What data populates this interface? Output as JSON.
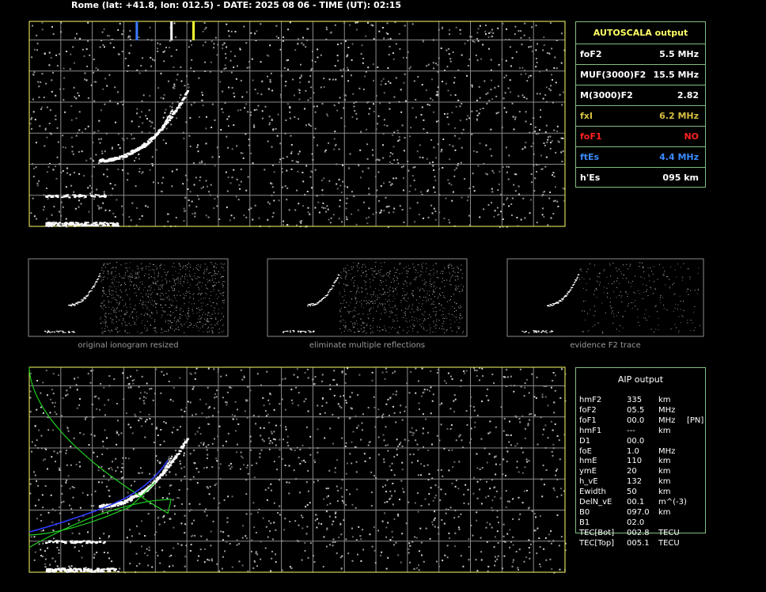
{
  "header": {
    "title": "Rome (lat: +41.8, lon: 012.5) - DATE: 2025 08 06 - TIME (UT): 02:15"
  },
  "main_ionogram": {
    "y_unit": "km",
    "x_unit": "MHz",
    "y_ticks": [
      "760",
      "700",
      "600",
      "500",
      "400",
      "300",
      "200",
      "100"
    ],
    "x_ticks": [
      "1",
      "2",
      "3",
      "4",
      "5",
      "6",
      "7",
      "8",
      "9",
      "10",
      "11",
      "12",
      "13",
      "14",
      "15",
      "16",
      "17",
      "18"
    ],
    "markers": [
      {
        "label": "ftEs",
        "freq": 4.4,
        "color": "#3a7bff"
      },
      {
        "label": "foF2",
        "freq": 5.5,
        "color": "#ffffff"
      },
      {
        "label": "fxI",
        "freq": 6.2,
        "color": "#ffff33"
      }
    ]
  },
  "autoscala": {
    "title": "AUTOSCALA output",
    "rows": [
      {
        "label": "foF2",
        "value": "5.5 MHz",
        "color": "#ffffff"
      },
      {
        "label": "MUF(3000)F2",
        "value": "15.5 MHz",
        "color": "#ffffff"
      },
      {
        "label": "M(3000)F2",
        "value": "2.82",
        "color": "#ffffff"
      },
      {
        "label": "fxI",
        "value": "6.2 MHz",
        "color": "#d8c040"
      },
      {
        "label": "foF1",
        "value": "NO",
        "color": "#ff2020"
      },
      {
        "label": "ftEs",
        "value": "4.4 MHz",
        "color": "#3a8bff"
      },
      {
        "label": "h'Es",
        "value": "095    km",
        "color": "#ffffff"
      }
    ]
  },
  "thumbnails": [
    {
      "caption": "original ionogram resized"
    },
    {
      "caption": "eliminate multiple reflections"
    },
    {
      "caption": "evidence F2 trace"
    }
  ],
  "aip_ionogram": {
    "y_unit": "km",
    "x_unit": "MHz",
    "y_ticks": [
      "760",
      "700",
      "600",
      "500",
      "400",
      "300",
      "200",
      "100"
    ],
    "x_ticks": [
      "1",
      "2",
      "3",
      "4",
      "5",
      "6",
      "7",
      "8",
      "9",
      "10",
      "11",
      "12",
      "13",
      "14",
      "15",
      "16",
      "17",
      "18"
    ]
  },
  "aip": {
    "title": "AIP output",
    "rows": [
      {
        "name": "hmF2",
        "value": "335",
        "unit": "km",
        "extra": ""
      },
      {
        "name": "foF2",
        "value": "05.5",
        "unit": "MHz",
        "extra": ""
      },
      {
        "name": "foF1",
        "value": "00.0",
        "unit": "MHz",
        "extra": "[PN]"
      },
      {
        "name": "hmF1",
        "value": "---",
        "unit": "km",
        "extra": ""
      },
      {
        "name": "D1",
        "value": "00.0",
        "unit": "",
        "extra": ""
      },
      {
        "name": "foE",
        "value": "1.0",
        "unit": "MHz",
        "extra": ""
      },
      {
        "name": "hmE",
        "value": "110",
        "unit": "km",
        "extra": ""
      },
      {
        "name": "ymE",
        "value": "20",
        "unit": "km",
        "extra": ""
      },
      {
        "name": "h_vE",
        "value": "132",
        "unit": "km",
        "extra": ""
      },
      {
        "name": "Ewidth",
        "value": "50",
        "unit": "km",
        "extra": ""
      },
      {
        "name": "DelN_vE",
        "value": "00.1",
        "unit": "m^(-3)",
        "extra": ""
      },
      {
        "name": "B0",
        "value": "097.0",
        "unit": "km",
        "extra": ""
      },
      {
        "name": "B1",
        "value": "02.0",
        "unit": "",
        "extra": ""
      },
      {
        "name": "TEC[Bot]",
        "value": "002.8",
        "unit": "TECU",
        "extra": ""
      },
      {
        "name": "TEC[Top]",
        "value": "005.1",
        "unit": "TECU",
        "extra": ""
      }
    ]
  }
}
